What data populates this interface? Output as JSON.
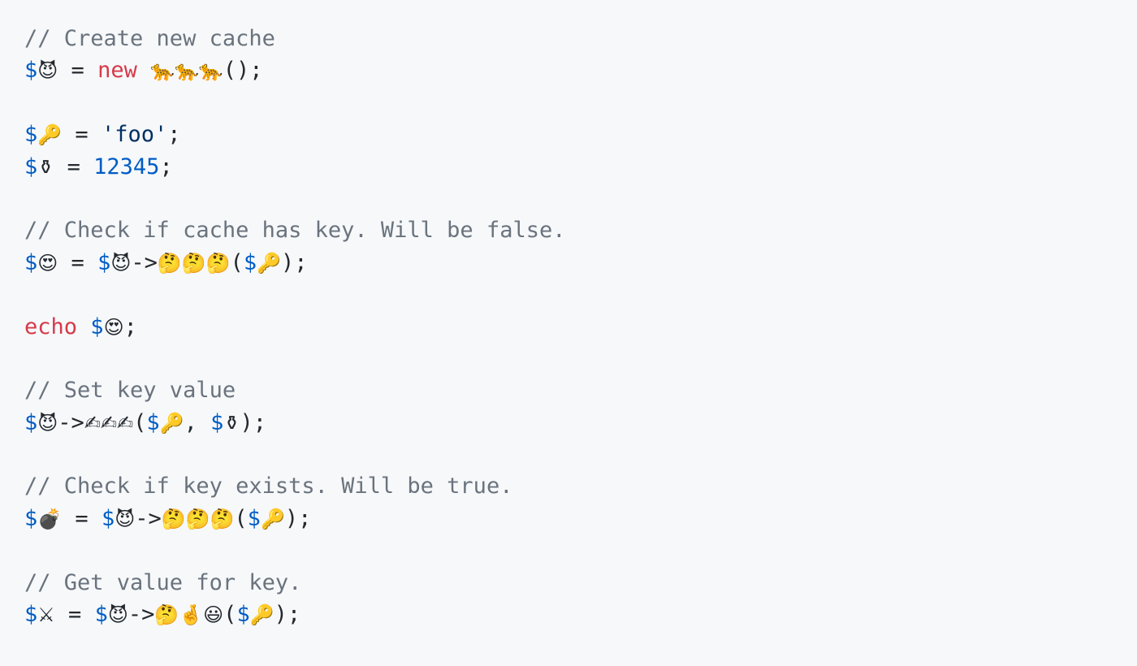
{
  "code": {
    "l1_comment": "// Create new cache",
    "l2_dollar": "$",
    "l2_var": "😈",
    "l2_eq": " = ",
    "l2_new": "new",
    "l2_space": " ",
    "l2_class": "🐆🐆🐆",
    "l2_rest": "();",
    "l4_dollar": "$",
    "l4_var": "🔑",
    "l4_eq": " = ",
    "l4_str": "'foo'",
    "l4_semi": ";",
    "l5_dollar": "$",
    "l5_var": "⚱",
    "l5_eq": " = ",
    "l5_num": "12345",
    "l5_semi": ";",
    "l7_comment": "// Check if cache has key. Will be false.",
    "l8_dollar": "$",
    "l8_var": "😍",
    "l8_eq": " = ",
    "l8_obj_dollar": "$",
    "l8_obj": "😈",
    "l8_arrow": "->",
    "l8_method": "🤔🤔🤔",
    "l8_open": "(",
    "l8_arg_dollar": "$",
    "l8_arg": "🔑",
    "l8_close": ");",
    "l10_echo": "echo",
    "l10_space": " ",
    "l10_dollar": "$",
    "l10_var": "😍",
    "l10_semi": ";",
    "l12_comment": "// Set key value",
    "l13_dollar": "$",
    "l13_obj": "😈",
    "l13_arrow": "->",
    "l13_method": "✍✍✍",
    "l13_open": "(",
    "l13_arg1_dollar": "$",
    "l13_arg1": "🔑",
    "l13_comma": ", ",
    "l13_arg2_dollar": "$",
    "l13_arg2": "⚱",
    "l13_close": ");",
    "l15_comment": "// Check if key exists. Will be true.",
    "l16_dollar": "$",
    "l16_var": "💣",
    "l16_eq": " = ",
    "l16_obj_dollar": "$",
    "l16_obj": "😈",
    "l16_arrow": "->",
    "l16_method": "🤔🤔🤔",
    "l16_open": "(",
    "l16_arg_dollar": "$",
    "l16_arg": "🔑",
    "l16_close": ");",
    "l18_comment": "// Get value for key.",
    "l19_dollar": "$",
    "l19_var": "⚔",
    "l19_eq": " = ",
    "l19_obj_dollar": "$",
    "l19_obj": "😈",
    "l19_arrow": "->",
    "l19_method": "🤔🤞😃",
    "l19_open": "(",
    "l19_arg_dollar": "$",
    "l19_arg": "🔑",
    "l19_close": ");"
  },
  "colors": {
    "background": "#f6f8fa",
    "comment": "#6a737d",
    "variable": "#005cc5",
    "keyword": "#d73a49",
    "string": "#032f62",
    "text": "#24292e"
  }
}
